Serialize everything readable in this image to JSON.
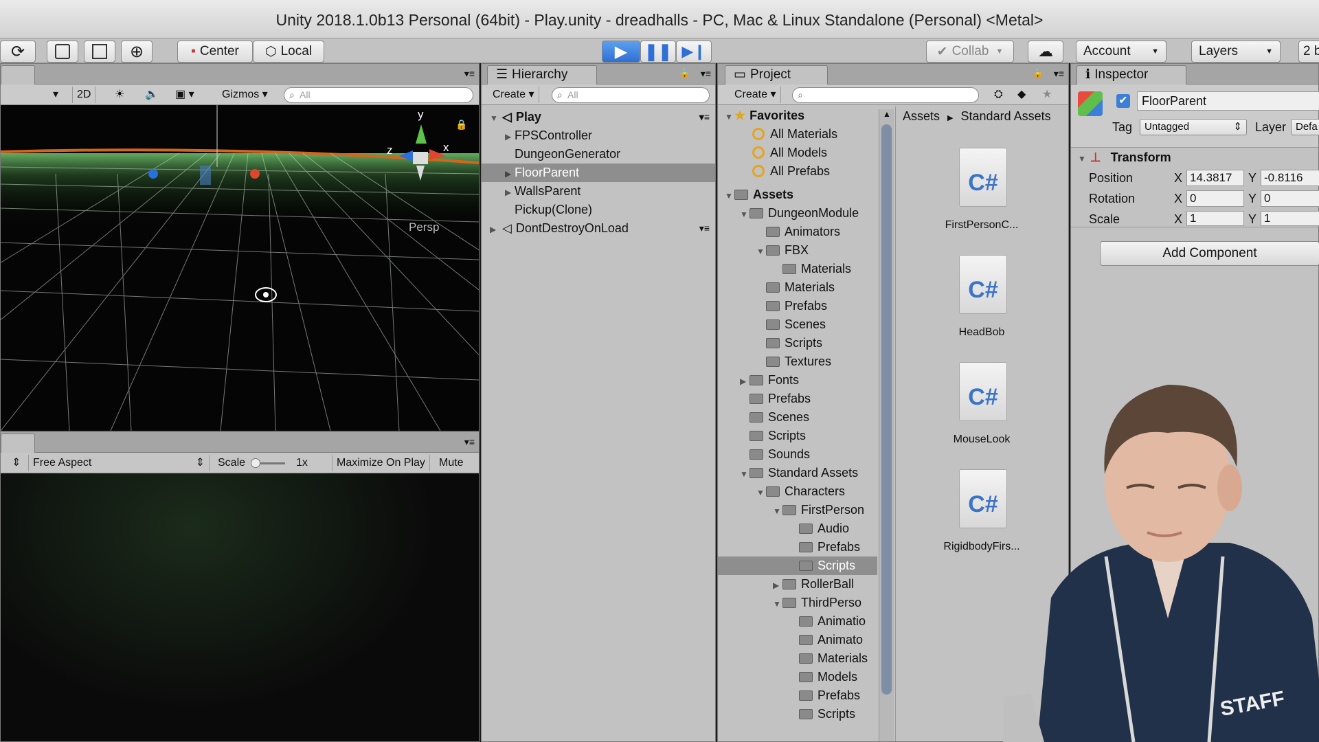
{
  "window": {
    "title": "Unity 2018.1.0b13 Personal (64bit) - Play.unity - dreadhalls - PC, Mac & Linux Standalone (Personal) <Metal>"
  },
  "toolbar": {
    "pivot_label": "Center",
    "space_label": "Local",
    "collab_label": "Collab",
    "account_label": "Account",
    "layers_label": "Layers",
    "layout_label": "2 b"
  },
  "scene": {
    "mode_2d": "2D",
    "gizmos_label": "Gizmos",
    "search_placeholder": "All",
    "persp_label": "Persp",
    "axis_x": "x",
    "axis_y": "y",
    "axis_z": "z"
  },
  "game": {
    "aspect_label": "Free Aspect",
    "scale_label": "Scale",
    "scale_value": "1x",
    "maximize_label": "Maximize On Play",
    "mute_label": "Mute Au"
  },
  "hierarchy": {
    "tab_label": "Hierarchy",
    "create_label": "Create",
    "search_placeholder": "All",
    "items": [
      {
        "label": "Play",
        "bold": true
      },
      {
        "label": "FPSController"
      },
      {
        "label": "DungeonGenerator"
      },
      {
        "label": "FloorParent",
        "selected": true
      },
      {
        "label": "WallsParent"
      },
      {
        "label": "Pickup(Clone)"
      },
      {
        "label": "DontDestroyOnLoad"
      }
    ]
  },
  "project": {
    "tab_label": "Project",
    "create_label": "Create",
    "favorites_label": "Favorites",
    "favorites": [
      "All Materials",
      "All Models",
      "All Prefabs"
    ],
    "assets_label": "Assets",
    "tree": [
      "DungeonModule",
      "Animators",
      "FBX",
      "Materials",
      "Materials",
      "Prefabs",
      "Scenes",
      "Scripts",
      "Textures",
      "Fonts",
      "Prefabs",
      "Scenes",
      "Scripts",
      "Sounds",
      "Standard Assets",
      "Characters",
      "FirstPerson",
      "Audio",
      "Prefabs",
      "Scripts",
      "RollerBall",
      "ThirdPerso",
      "Animatio",
      "Animato",
      "Materials",
      "Models",
      "Prefabs",
      "Scripts"
    ],
    "breadcrumb": [
      "Assets",
      "Standard Assets"
    ],
    "files": [
      {
        "icon": "C#",
        "label": "FirstPersonC..."
      },
      {
        "icon": "C#",
        "label": "HeadBob"
      },
      {
        "icon": "C#",
        "label": "MouseLook"
      },
      {
        "icon": "C#",
        "label": "RigidbodyFirs..."
      }
    ]
  },
  "inspector": {
    "tab_label": "Inspector",
    "object_name": "FloorParent",
    "tag_label": "Tag",
    "tag_value": "Untagged",
    "layer_label": "Layer",
    "layer_value": "Defa",
    "transform_label": "Transform",
    "position_label": "Position",
    "rotation_label": "Rotation",
    "scale_label": "Scale",
    "x_label": "X",
    "y_label": "Y",
    "pos_x": "14.3817",
    "pos_y": "-0.8116",
    "rot_x": "0",
    "rot_y": "0",
    "scale_x": "1",
    "scale_y": "1",
    "add_component": "Add Component"
  },
  "overlay": {
    "shirt_text": "STAFF"
  }
}
